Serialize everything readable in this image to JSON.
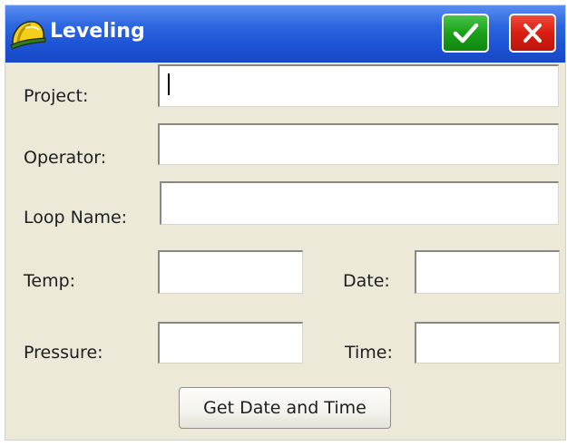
{
  "window": {
    "title": "Leveling",
    "title_icon": "hard-hat-icon",
    "ok_icon": "checkmark-icon",
    "close_icon": "close-icon"
  },
  "form": {
    "project_label": "Project:",
    "project_value": "",
    "operator_label": "Operator:",
    "operator_value": "",
    "loop_name_label": "Loop Name:",
    "loop_name_value": "",
    "temp_label": "Temp:",
    "temp_value": "",
    "date_label": "Date:",
    "date_value": "",
    "pressure_label": "Pressure:",
    "pressure_value": "",
    "time_label": "Time:",
    "time_value": ""
  },
  "actions": {
    "get_date_time_label": "Get Date and Time"
  },
  "colors": {
    "titlebar": "#1c53d6",
    "window_bg": "#ece9d8",
    "ok_green": "#1aa01a",
    "close_red": "#d81e12"
  }
}
